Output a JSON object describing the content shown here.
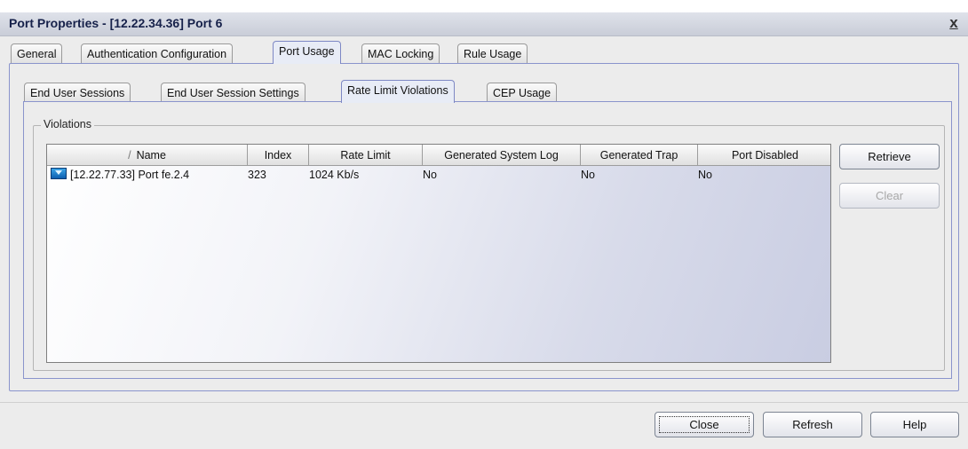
{
  "window": {
    "title": "Port Properties - [12.22.34.36] Port 6",
    "close_glyph": "x"
  },
  "main_tabs": [
    {
      "label": "General"
    },
    {
      "label": "Authentication Configuration"
    },
    {
      "label": "Port Usage",
      "active": true
    },
    {
      "label": "MAC Locking"
    },
    {
      "label": "Rule Usage"
    }
  ],
  "sub_tabs": [
    {
      "label": "End User Sessions"
    },
    {
      "label": "End User Session Settings"
    },
    {
      "label": "Rate Limit Violations",
      "active": true
    },
    {
      "label": "CEP Usage"
    }
  ],
  "violations": {
    "group_label": "Violations",
    "sort_indicator": "/",
    "columns": [
      "Name",
      "Index",
      "Rate Limit",
      "Generated System Log",
      "Generated Trap",
      "Port Disabled"
    ],
    "rows": [
      {
        "icon": "port-icon",
        "name": "[12.22.77.33] Port fe.2.4",
        "index": "323",
        "rate_limit": "1024 Kb/s",
        "generated_system_log": "No",
        "generated_trap": "No",
        "port_disabled": "No"
      }
    ]
  },
  "side_buttons": {
    "retrieve": "Retrieve",
    "clear": "Clear"
  },
  "footer_buttons": {
    "close": "Close",
    "refresh": "Refresh",
    "help": "Help"
  }
}
